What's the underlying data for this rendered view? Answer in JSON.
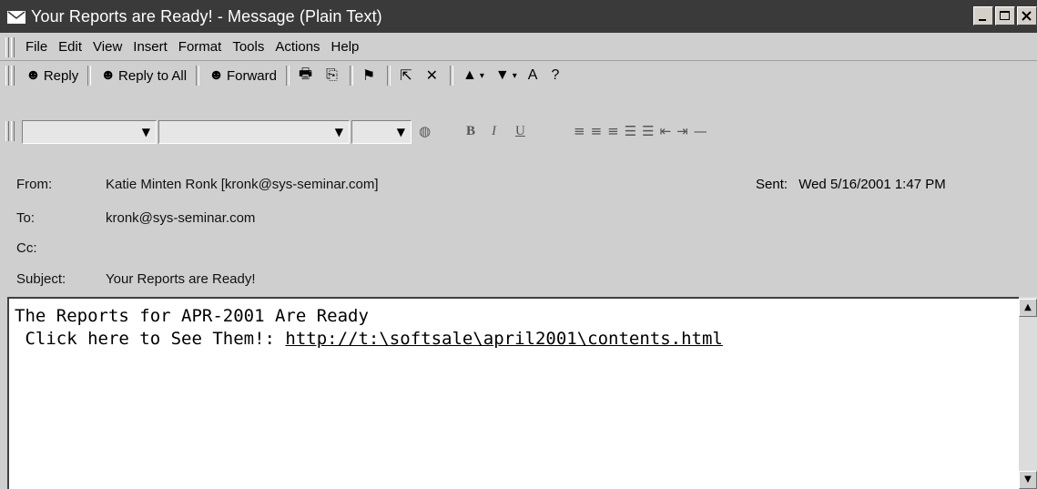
{
  "window": {
    "title": "Your Reports are Ready! - Message (Plain Text)",
    "controls": [
      "_",
      "□",
      "×"
    ]
  },
  "menu": {
    "items": [
      {
        "label": "File"
      },
      {
        "label": "Edit"
      },
      {
        "label": "View"
      },
      {
        "label": "Insert"
      },
      {
        "label": "Format"
      },
      {
        "label": "Tools"
      },
      {
        "label": "Actions"
      },
      {
        "label": "Help"
      }
    ]
  },
  "toolbar": {
    "reply": "Reply",
    "reply_all": "Reply to All",
    "forward": "Forward"
  },
  "formatting": {
    "bold": "B",
    "italic": "I",
    "underline": "U"
  },
  "header": {
    "from_label": "From:",
    "from_value": "Katie Minten Ronk [kronk@sys-seminar.com]",
    "to_label": "To:",
    "to_value": "kronk@sys-seminar.com",
    "cc_label": "Cc:",
    "cc_value": "",
    "subject_label": "Subject:",
    "subject_value": "Your Reports are Ready!",
    "sent_label": "Sent:",
    "sent_value": "Wed 5/16/2001 1:47 PM"
  },
  "body": {
    "line1": "The Reports for APR-2001 Are Ready",
    "line2_prefix": " Click here to See Them!: ",
    "link": "http://t:\\softsale\\april2001\\contents.html"
  }
}
